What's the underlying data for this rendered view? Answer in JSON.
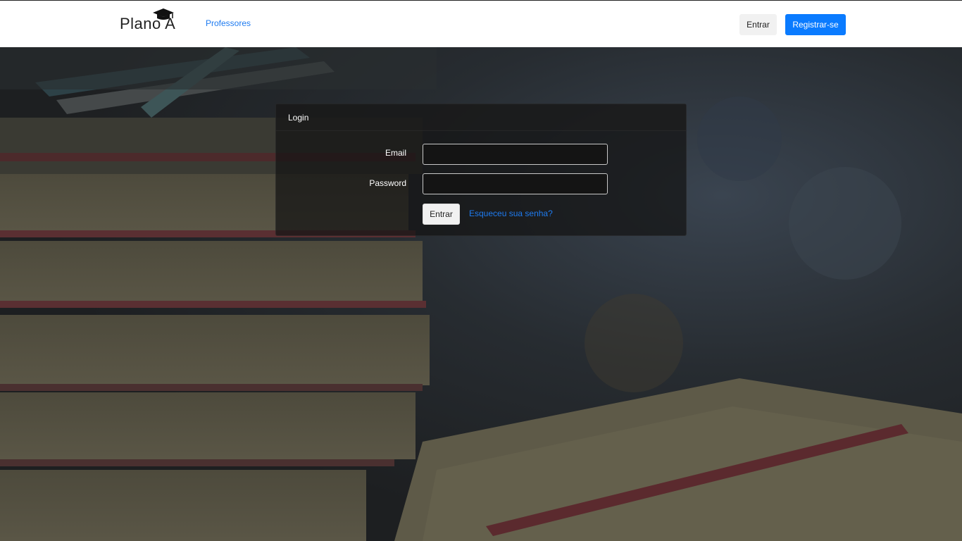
{
  "header": {
    "brand": "Plano A",
    "nav_link": "Professores",
    "login_button": "Entrar",
    "register_button": "Registrar-se"
  },
  "login_card": {
    "title": "Login",
    "email_label": "Email",
    "email_value": "",
    "password_label": "Password",
    "password_value": "",
    "submit_button": "Entrar",
    "forgot_link": "Esqueceu sua senha?"
  },
  "colors": {
    "primary": "#0a7bff",
    "link": "#1e7bf0",
    "navbar_bg": "#ffffff",
    "card_bg": "#141414"
  },
  "icons": {
    "brand_logo": "graduation-cap-icon"
  }
}
